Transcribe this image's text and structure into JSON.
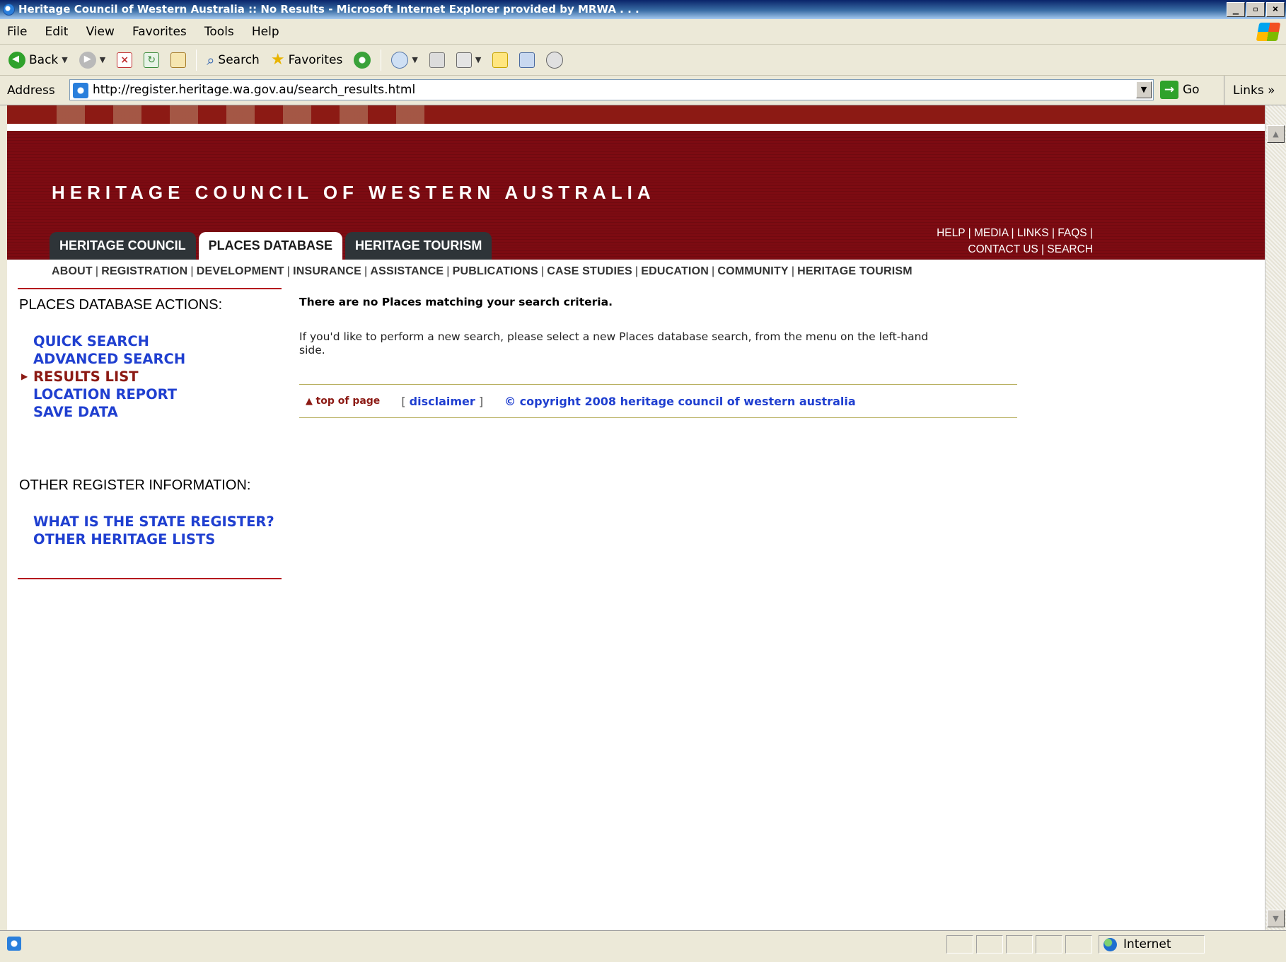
{
  "window": {
    "title": "Heritage Council of Western Australia :: No Results - Microsoft Internet Explorer provided by MRWA . . .",
    "min_label": "_",
    "max_label": "▫",
    "close_label": "×"
  },
  "menubar": [
    "File",
    "Edit",
    "View",
    "Favorites",
    "Tools",
    "Help"
  ],
  "toolbar": {
    "back_label": "Back",
    "search_label": "Search",
    "favorites_label": "Favorites"
  },
  "address": {
    "label": "Address",
    "url": "http://register.heritage.wa.gov.au/search_results.html",
    "go_label": "Go",
    "links_label": "Links"
  },
  "site": {
    "title": "HERITAGE COUNCIL OF WESTERN AUSTRALIA",
    "tabs": [
      "HERITAGE COUNCIL",
      "PLACES DATABASE",
      "HERITAGE TOURISM"
    ],
    "active_tab": "PLACES DATABASE",
    "top_links": {
      "help": "HELP",
      "media": "MEDIA",
      "links": "LINKS",
      "faqs": "FAQS",
      "contact": "CONTACT US",
      "search": "SEARCH"
    },
    "section_nav": [
      "ABOUT",
      "REGISTRATION",
      "DEVELOPMENT",
      "INSURANCE",
      "ASSISTANCE",
      "PUBLICATIONS",
      "CASE STUDIES",
      "EDUCATION",
      "COMMUNITY",
      "HERITAGE TOURISM"
    ]
  },
  "sidebar": {
    "actions_heading": "PLACES DATABASE ACTIONS:",
    "actions": [
      "QUICK SEARCH",
      "ADVANCED SEARCH",
      "RESULTS LIST",
      "LOCATION REPORT",
      "SAVE DATA"
    ],
    "current_action": "RESULTS LIST",
    "info_heading": "OTHER REGISTER INFORMATION:",
    "info_links": [
      "WHAT IS THE STATE REGISTER?",
      "OTHER HERITAGE LISTS"
    ]
  },
  "main": {
    "no_results": "There are no Places matching your search criteria.",
    "instructions": "If you'd like to perform a new search, please select a new Places database search, from the menu on the left-hand side.",
    "top_of_page": "top of page",
    "disclaimer": "disclaimer",
    "copyright": "© copyright 2008 heritage council of western australia"
  },
  "status": {
    "text": "",
    "zone": "Internet"
  }
}
